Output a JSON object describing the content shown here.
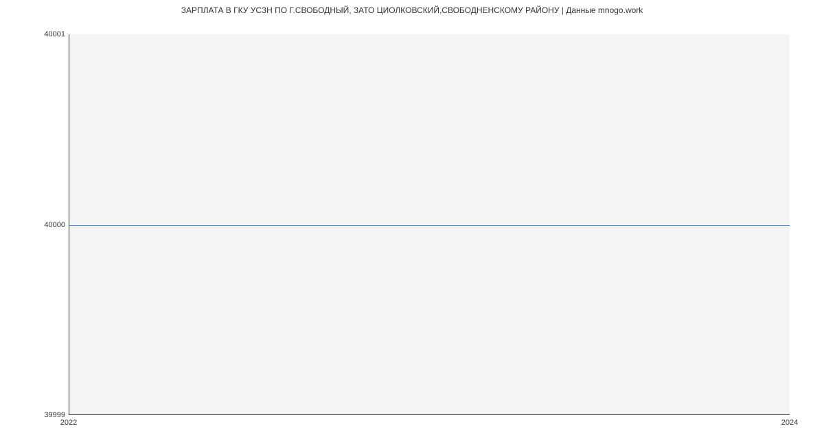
{
  "chart_data": {
    "type": "line",
    "title": "ЗАРПЛАТА В ГКУ УСЗН ПО Г.СВОБОДНЫЙ, ЗАТО ЦИОЛКОВСКИЙ,СВОБОДНЕНСКОМУ РАЙОНУ | Данные mnogo.work",
    "x": [
      2022,
      2024
    ],
    "values": [
      40000,
      40000
    ],
    "xlabel": "",
    "ylabel": "",
    "xlim": [
      2022,
      2024
    ],
    "ylim": [
      39999,
      40001
    ],
    "x_ticks": [
      2022,
      2024
    ],
    "y_ticks": [
      39999,
      40000,
      40001
    ],
    "line_color": "#4a86e8",
    "plot_bg": "#f4f4f4"
  },
  "ticks": {
    "y0": "39999",
    "y1": "40000",
    "y2": "40001",
    "x0": "2022",
    "x1": "2024"
  }
}
